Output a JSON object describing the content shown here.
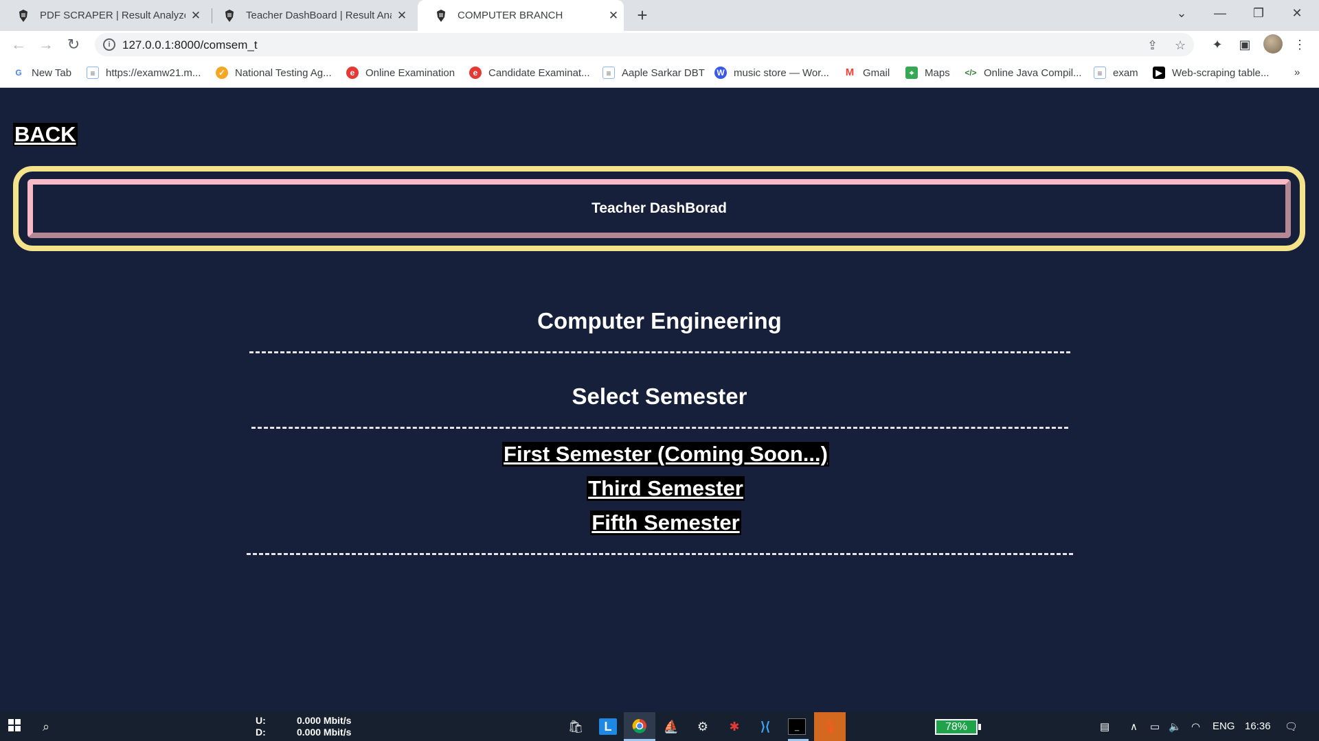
{
  "browser": {
    "tabs": [
      {
        "title": "PDF SCRAPER | Result Analyzer S",
        "active": false
      },
      {
        "title": "Teacher DashBoard | Result Analy",
        "active": false
      },
      {
        "title": "COMPUTER BRANCH",
        "active": true
      }
    ],
    "new_tab": "+",
    "url": "127.0.0.1:8000/comsem_t",
    "bookmarks": [
      {
        "label": "New Tab",
        "icon": "google-icon"
      },
      {
        "label": "https://examw21.m...",
        "icon": "page-icon"
      },
      {
        "label": "National Testing Ag...",
        "icon": "nta-icon"
      },
      {
        "label": "Online Examination",
        "icon": "exam-icon"
      },
      {
        "label": "Candidate Examinat...",
        "icon": "exam-icon"
      },
      {
        "label": "Aaple Sarkar DBT",
        "icon": "page-icon"
      },
      {
        "label": "music store — Wor...",
        "icon": "wordpress-icon"
      },
      {
        "label": "Gmail",
        "icon": "gmail-icon"
      },
      {
        "label": "Maps",
        "icon": "maps-icon"
      },
      {
        "label": "Online Java Compil...",
        "icon": "code-icon"
      },
      {
        "label": "exam",
        "icon": "page-icon"
      },
      {
        "label": "Web-scraping table...",
        "icon": "video-icon"
      }
    ],
    "more_bookmarks": "»"
  },
  "page": {
    "back_label": "BACK",
    "banner_title": "Teacher DashBorad",
    "branch_heading": "Computer Engineering",
    "select_heading": "Select Semester",
    "semesters": [
      {
        "label": "First Semester (Coming Soon...)"
      },
      {
        "label": "Third Semester"
      },
      {
        "label": "Fifth Semester"
      }
    ]
  },
  "taskbar": {
    "upload_label": "U:",
    "upload_value": "0.000 Mbit/s",
    "download_label": "D:",
    "download_value": "0.000 Mbit/s",
    "battery": "78%",
    "language": "ENG",
    "time": "16:36"
  },
  "colors": {
    "page_bg": "#17203a",
    "frame_yellow": "#f3e48c",
    "frame_pink": "#f7b9c5",
    "battery_green": "#1ea34a"
  }
}
